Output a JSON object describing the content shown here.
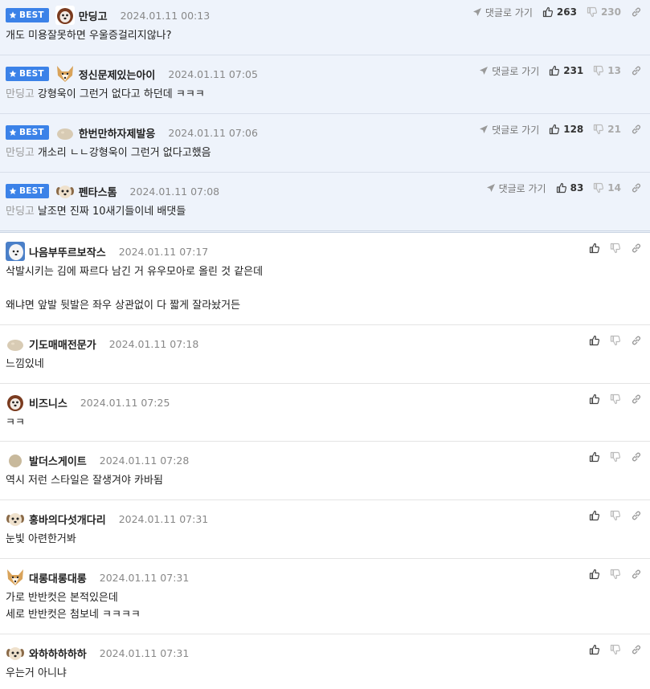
{
  "ui": {
    "best_badge": "BEST",
    "goto_reply": "댓글로 가기"
  },
  "best_comments": [
    {
      "nick": "만딩고",
      "date": "2024.01.11 00:13",
      "avatar": "dog-face",
      "up": "263",
      "down": "230",
      "quote": "",
      "lines": [
        "개도 미용잘못하면 우울증걸리지않나?"
      ]
    },
    {
      "nick": "정신문제있는아이",
      "date": "2024.01.11 07:05",
      "avatar": "fox-face",
      "up": "231",
      "down": "13",
      "quote": "만딩고",
      "lines": [
        "강형욱이 그런거 없다고 하던데 ㅋㅋㅋ"
      ]
    },
    {
      "nick": "한번만하자제발응",
      "date": "2024.01.11 07:06",
      "avatar": "blob",
      "up": "128",
      "down": "21",
      "quote": "만딩고",
      "lines": [
        "개소리 ㄴㄴ강형욱이 그런거 없다고했음"
      ]
    },
    {
      "nick": "펜타스톰",
      "date": "2024.01.11 07:08",
      "avatar": "puppy",
      "up": "83",
      "down": "14",
      "quote": "만딩고",
      "lines": [
        "날조면 진짜 10새기들이네 배댓들"
      ]
    }
  ],
  "comments": [
    {
      "nick": "나음부뚜르보작스",
      "date": "2024.01.11 07:17",
      "avatar": "white-dog",
      "lines": [
        "삭발시키는 김에 짜르다 남긴 거 유우모아로 올린 것 같은데",
        "",
        "왜냐면 앞발 뒷발은 좌우 상관없이 다 짧게 잘라놨거든"
      ]
    },
    {
      "nick": "기도매매전문가",
      "date": "2024.01.11 07:18",
      "avatar": "blob",
      "lines": [
        "느낌있네"
      ]
    },
    {
      "nick": "비즈니스",
      "date": "2024.01.11 07:25",
      "avatar": "dog-face",
      "lines": [
        "ㅋㅋ"
      ]
    },
    {
      "nick": "발더스게이트",
      "date": "2024.01.11 07:28",
      "avatar": "dot",
      "lines": [
        "역시 저런 스타일은 잘생겨야 카바됨"
      ]
    },
    {
      "nick": "홍바의다섯개다리",
      "date": "2024.01.11 07:31",
      "avatar": "puppy",
      "lines": [
        "눈빛 아련한거봐"
      ]
    },
    {
      "nick": "대롱대롱대롱",
      "date": "2024.01.11 07:31",
      "avatar": "fox-face",
      "lines": [
        "가로 반반컷은 본적있은데",
        "세로 반반컷은 첨보네 ㅋㅋㅋㅋ"
      ]
    },
    {
      "nick": "와하하하하하",
      "date": "2024.01.11 07:31",
      "avatar": "puppy",
      "lines": [
        "우는거 아니냐"
      ]
    }
  ],
  "colors": {
    "best_bg": "#eef3fb",
    "badge": "#3b82e8"
  }
}
